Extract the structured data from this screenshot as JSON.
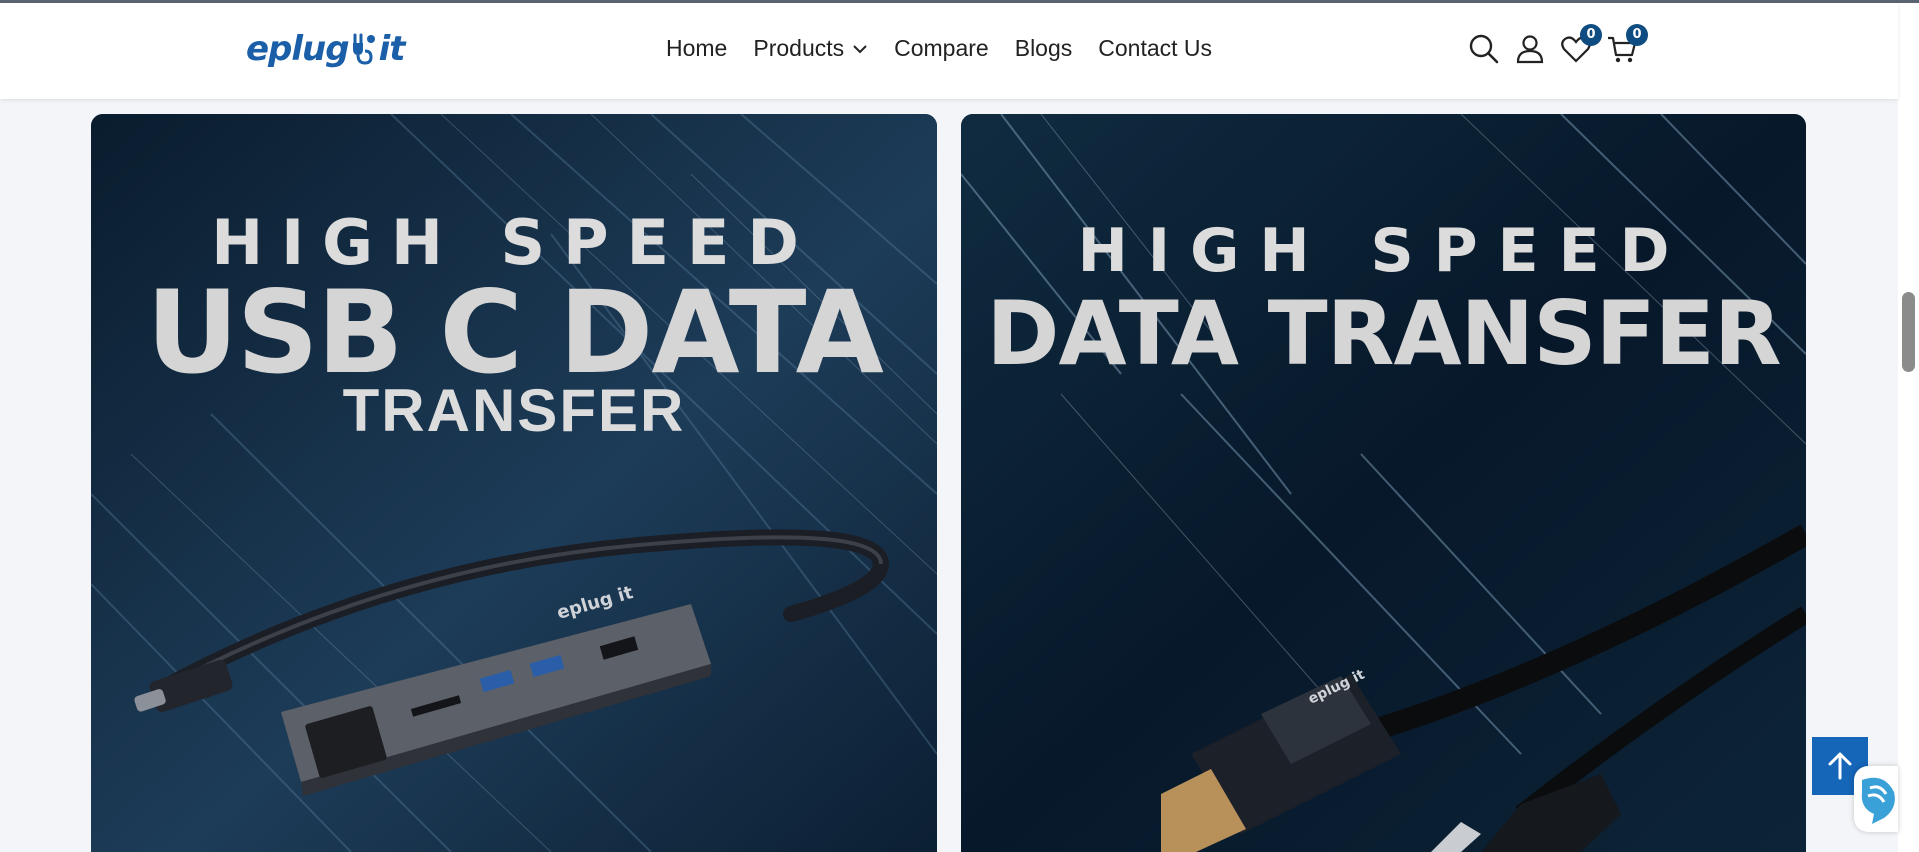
{
  "brand": {
    "logo_text_left": "eplug",
    "logo_text_right": "it"
  },
  "nav": {
    "items": [
      {
        "label": "Home"
      },
      {
        "label": "Products",
        "has_dropdown": true
      },
      {
        "label": "Compare"
      },
      {
        "label": "Blogs"
      },
      {
        "label": "Contact Us"
      }
    ]
  },
  "header_icons": {
    "search": "search-icon",
    "account": "user-icon",
    "wishlist": {
      "icon": "heart-icon",
      "count": "0"
    },
    "cart": {
      "icon": "cart-icon",
      "count": "0"
    }
  },
  "banners": [
    {
      "line1": "HIGH SPEED",
      "line2": "USB C DATA",
      "line3": "TRANSFER",
      "product_brand": "eplug it"
    },
    {
      "line1": "HIGH SPEED",
      "line2": "DATA TRANSFER",
      "product_brand": "eplug it"
    }
  ],
  "colors": {
    "accent": "#1565b8",
    "badge": "#0f4c81",
    "banner_bg": "#0e2236",
    "logo": "#1a5fa8"
  },
  "floating": {
    "back_to_top": "arrow-up-icon",
    "chat": "chat-widget-icon"
  }
}
